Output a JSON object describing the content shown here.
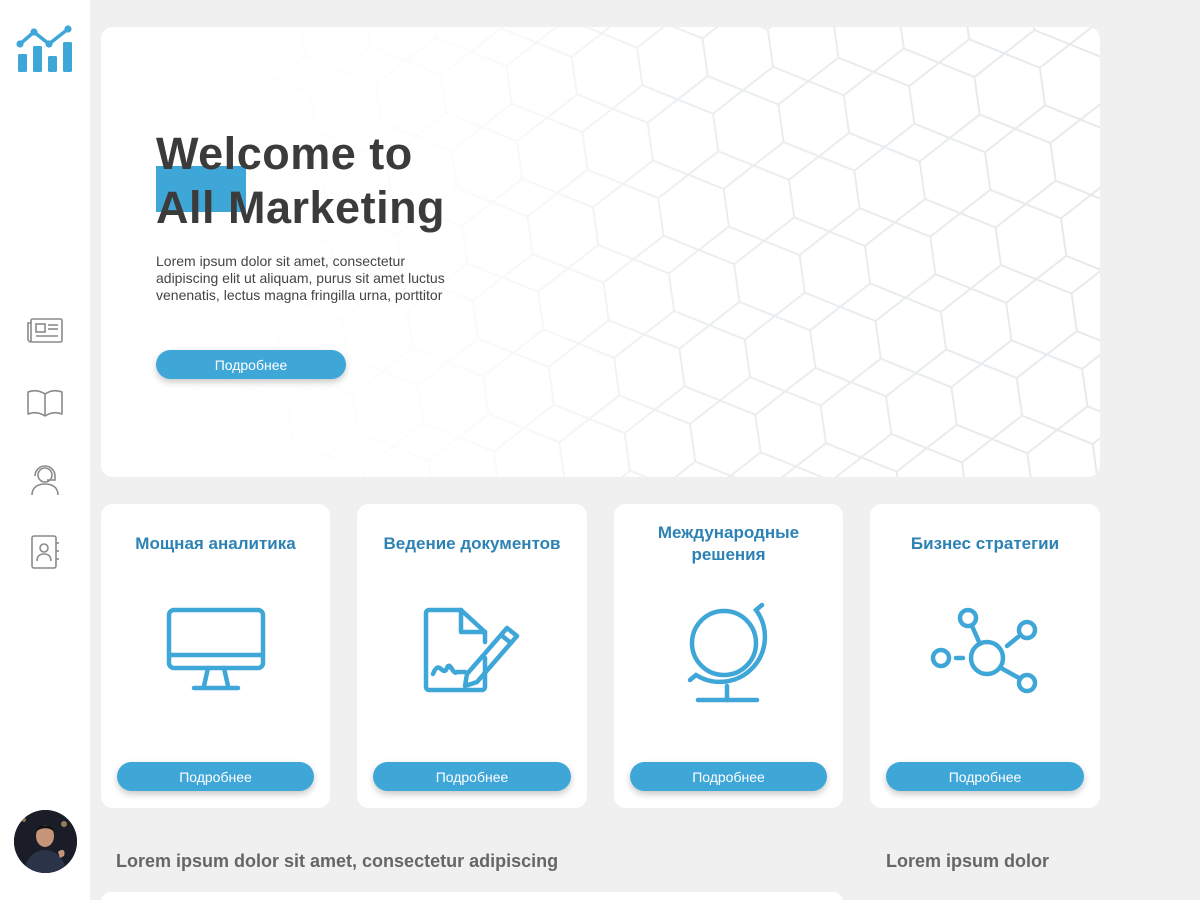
{
  "brand": {
    "logo_icon": "analytics-chart-icon",
    "accent_color": "#3fa6d8",
    "title_color": "#2d82b5"
  },
  "sidebar": {
    "items": [
      {
        "icon": "newspaper-icon",
        "label": ""
      },
      {
        "icon": "open-book-icon",
        "label": ""
      },
      {
        "icon": "support-agent-icon",
        "label": ""
      },
      {
        "icon": "contacts-book-icon",
        "label": ""
      }
    ],
    "avatar": "user-avatar"
  },
  "hero": {
    "title_line1": "Welcome to",
    "title_line2": "All Marketing",
    "text": "Lorem ipsum dolor sit amet, consectetur adipiscing elit ut aliquam, purus sit amet luctus venenatis, lectus magna fringilla urna, porttitor",
    "button": "Подробнее"
  },
  "cards": [
    {
      "title": "Мощная аналитика",
      "icon": "monitor-icon",
      "button": "Подробнее"
    },
    {
      "title": "Ведение документов",
      "icon": "document-sign-icon",
      "button": "Подробнее"
    },
    {
      "title": "Международные решения",
      "icon": "globe-icon",
      "button": "Подробнее"
    },
    {
      "title": "Бизнес стратегии",
      "icon": "network-nodes-icon",
      "button": "Подробнее"
    }
  ],
  "bottom": {
    "left_title": "Lorem ipsum dolor sit amet, consectetur adipiscing",
    "right_title": "Lorem ipsum dolor"
  }
}
